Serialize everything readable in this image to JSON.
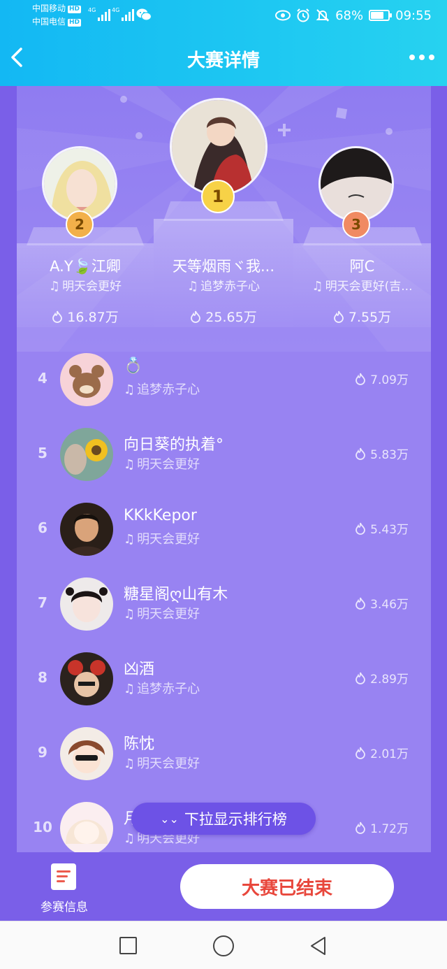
{
  "status_bar": {
    "carrier1": "中国移动",
    "carrier2": "中国电信",
    "hd": "HD",
    "network": "4G",
    "battery": "68%",
    "time": "09:55"
  },
  "header": {
    "title": "大赛详情"
  },
  "podium": [
    {
      "rank": "1",
      "name": "天等烟雨ヾ我...",
      "song": "追梦赤子心",
      "score": "25.65万"
    },
    {
      "rank": "2",
      "name": "A.Y🍃江卿",
      "song": "明天会更好",
      "score": "16.87万"
    },
    {
      "rank": "3",
      "name": "阿C",
      "song": "明天会更好(吉...",
      "score": "7.55万"
    }
  ],
  "list": [
    {
      "rank": "4",
      "name": "💍",
      "song": "追梦赤子心",
      "score": "7.09万"
    },
    {
      "rank": "5",
      "name": "向日葵的执着°",
      "song": "明天会更好",
      "score": "5.83万"
    },
    {
      "rank": "6",
      "name": "KKkKepor",
      "song": "明天会更好",
      "score": "5.43万"
    },
    {
      "rank": "7",
      "name": "糖星阁ღ山有木",
      "song": "明天会更好",
      "score": "3.46万"
    },
    {
      "rank": "8",
      "name": "凶酒",
      "song": "追梦赤子心",
      "score": "2.89万"
    },
    {
      "rank": "9",
      "name": "陈忱",
      "song": "明天会更好",
      "score": "2.01万"
    },
    {
      "rank": "10",
      "name": "月",
      "song": "明天会更好",
      "score": "1.72万"
    }
  ],
  "pull_hint": "下拉显示排行榜",
  "bottom": {
    "info_label": "参赛信息",
    "ended_label": "大赛已结束"
  },
  "colors": {
    "header": "#1ec8f2",
    "board": "#9883f2",
    "ended_text": "#e8473c",
    "gold": "#f7d247",
    "silver": "#f2b04a",
    "bronze": "#f08a62"
  }
}
